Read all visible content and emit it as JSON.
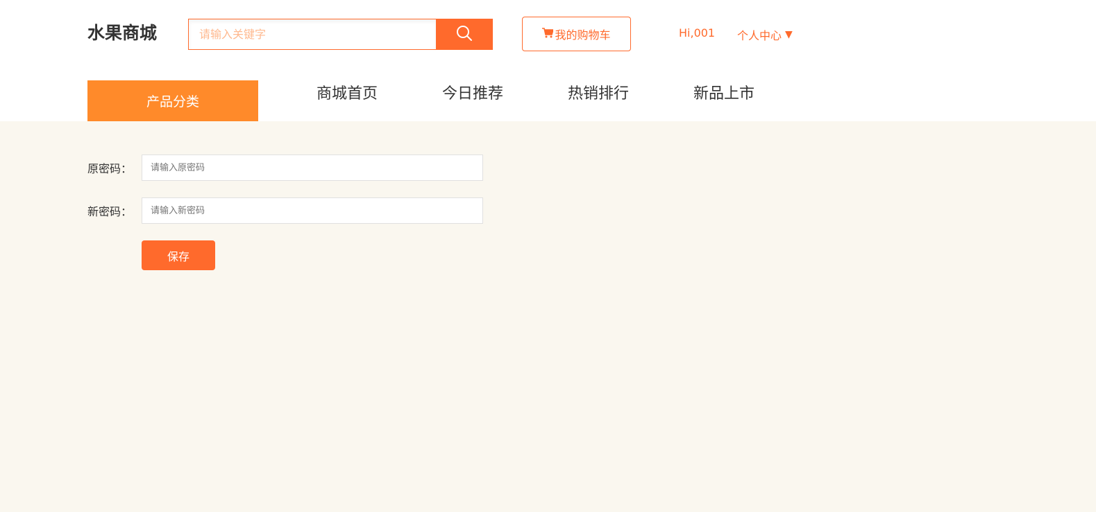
{
  "header": {
    "logo": "水果商城",
    "search": {
      "placeholder": "请输入关键字",
      "value": "",
      "icon": "search-icon"
    },
    "cart_label": "我的购物车",
    "cart_icon": "cart-icon",
    "greeting": "Hi,001",
    "user_center_label": "个人中心",
    "user_center_caret": "▼"
  },
  "nav": {
    "category_label": "产品分类",
    "items": [
      {
        "label": "商城首页"
      },
      {
        "label": "今日推荐"
      },
      {
        "label": "热销排行"
      },
      {
        "label": "新品上市"
      }
    ]
  },
  "form": {
    "old_password": {
      "label": "原密码：",
      "placeholder": "请输入原密码",
      "value": ""
    },
    "new_password": {
      "label": "新密码：",
      "placeholder": "请输入新密码",
      "value": ""
    },
    "save_label": "保存"
  },
  "colors": {
    "accent": "#ff6a2c",
    "category_bg": "#ff8a2a",
    "content_bg": "#faf7ef",
    "text": "#333333"
  }
}
